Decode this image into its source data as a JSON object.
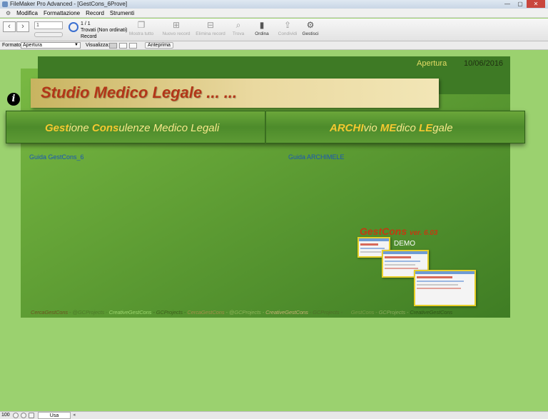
{
  "window": {
    "title": "FileMaker Pro Advanced - [GestCons_6Prove]",
    "buttons": [
      "—",
      "▢",
      "✕"
    ]
  },
  "menubar": {
    "items": [
      "Modifica",
      "Formattazione",
      "Record",
      "Strumenti"
    ]
  },
  "toolbar": {
    "record_number": "1",
    "record_count": "1 / 1",
    "found_text": "Trovati (Non ordinati)",
    "record_label": "Record",
    "buttons": [
      {
        "label": "Mostra tutto",
        "icon": "show-all-icon"
      },
      {
        "label": "Nuovo record",
        "icon": "new-record-icon"
      },
      {
        "label": "Elimina record",
        "icon": "delete-record-icon"
      },
      {
        "label": "Trova",
        "icon": "search-icon"
      },
      {
        "label": "Ordina",
        "icon": "sort-icon"
      },
      {
        "label": "Condividi",
        "icon": "share-icon"
      },
      {
        "label": "Gestisci",
        "icon": "gear-icon"
      }
    ]
  },
  "layoutbar": {
    "format_label": "Formato:",
    "format_value": "Apertura",
    "view_label": "Visualizza:",
    "preview_label": "Anteprima"
  },
  "content": {
    "header_title": "Apertura",
    "header_date": "10/06/2016",
    "studio_title": "Studio Medico Legale ... ...",
    "gestcons_button": {
      "parts": [
        "Gest",
        "ione ",
        "Cons",
        "ulenze Medico Legali"
      ]
    },
    "archimele_button": {
      "parts": [
        "ARCHI",
        "vio ",
        "ME",
        "dico ",
        "LE",
        "gale"
      ]
    },
    "guide_left": "Guida GestCons_6",
    "guide_right": "Guida ARCHIMELE",
    "logo_text": "GestCons",
    "logo_version": "ver. 6.03",
    "demo_label": "DEMO",
    "footer_segments": [
      {
        "text": "CercaGestCons",
        "color": "#6b5320"
      },
      {
        "text": " - @GCProjects - ",
        "color": "#4e7a2a"
      },
      {
        "text": "CreativeGestCons",
        "color": "#9ed66f"
      },
      {
        "text": " - GCProjects - ",
        "color": "#3e5f1c"
      },
      {
        "text": "CercaGestCons",
        "color": "#a38e4a"
      },
      {
        "text": " - @GCProjects - ",
        "color": "#8fb35a"
      },
      {
        "text": "CreativeGestCons",
        "color": "#c7b073"
      },
      {
        "text": " - GCProjects - ",
        "color": "#4f6e2a"
      },
      {
        "text": "     GestCons - ",
        "color": "#7a9c48"
      },
      {
        "text": "GCProjects - ",
        "color": "#8aa85c"
      },
      {
        "text": "CreativeGestCons",
        "color": "#2f5418"
      }
    ]
  },
  "statusbar": {
    "zoom": "100",
    "mode": "Usa"
  }
}
